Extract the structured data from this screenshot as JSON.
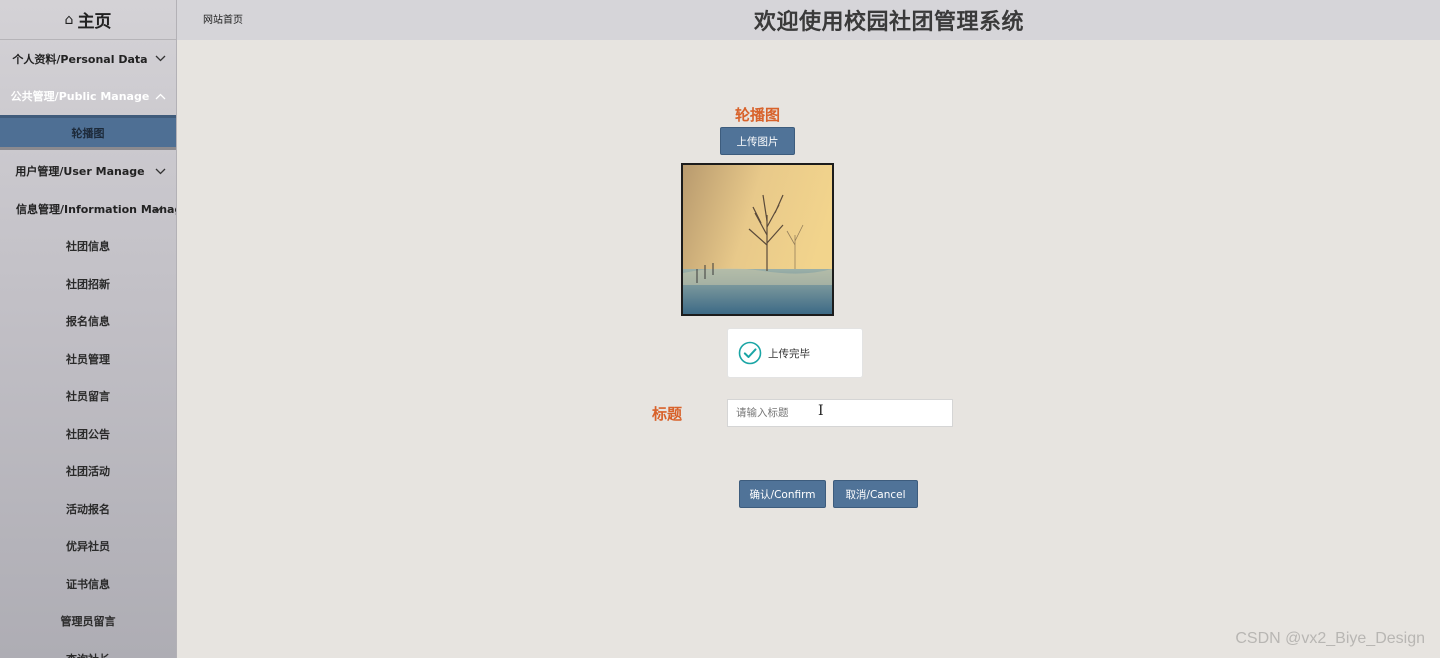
{
  "sidebar": {
    "home_label": "主页",
    "home_icon": "home-icon",
    "menu": [
      {
        "label": "个人资料/Personal Data",
        "type": "parent",
        "state": "collapsed"
      },
      {
        "label": "公共管理/Public Manage",
        "type": "parent",
        "state": "expanded"
      },
      {
        "label": "轮播图",
        "type": "child",
        "active": true
      },
      {
        "label": "用户管理/User Manage",
        "type": "parent",
        "state": "collapsed"
      },
      {
        "label": "信息管理/Information Manage",
        "type": "parent",
        "state": "expanded"
      },
      {
        "label": "社团信息",
        "type": "child"
      },
      {
        "label": "社团招新",
        "type": "child"
      },
      {
        "label": "报名信息",
        "type": "child"
      },
      {
        "label": "社员管理",
        "type": "child"
      },
      {
        "label": "社员留言",
        "type": "child"
      },
      {
        "label": "社团公告",
        "type": "child"
      },
      {
        "label": "社团活动",
        "type": "child"
      },
      {
        "label": "活动报名",
        "type": "child"
      },
      {
        "label": "优异社员",
        "type": "child"
      },
      {
        "label": "证书信息",
        "type": "child"
      },
      {
        "label": "管理员留言",
        "type": "child"
      },
      {
        "label": "查询社长",
        "type": "child"
      }
    ]
  },
  "header": {
    "breadcrumb": "网站首页",
    "title": "欢迎使用校园社团管理系统"
  },
  "form": {
    "carousel_label": "轮播图",
    "upload_button": "上传图片",
    "upload_status": "上传完毕",
    "title_label": "标题",
    "title_placeholder": "请输入标题",
    "title_value": "",
    "confirm_button": "确认/Confirm",
    "cancel_button": "取消/Cancel"
  },
  "watermark": "CSDN @vx2_Biye_Design",
  "colors": {
    "accent_button": "#507398",
    "label_orange": "#d8622b",
    "active_menu": "#4e6f94",
    "success_check": "#1aa5a5"
  }
}
